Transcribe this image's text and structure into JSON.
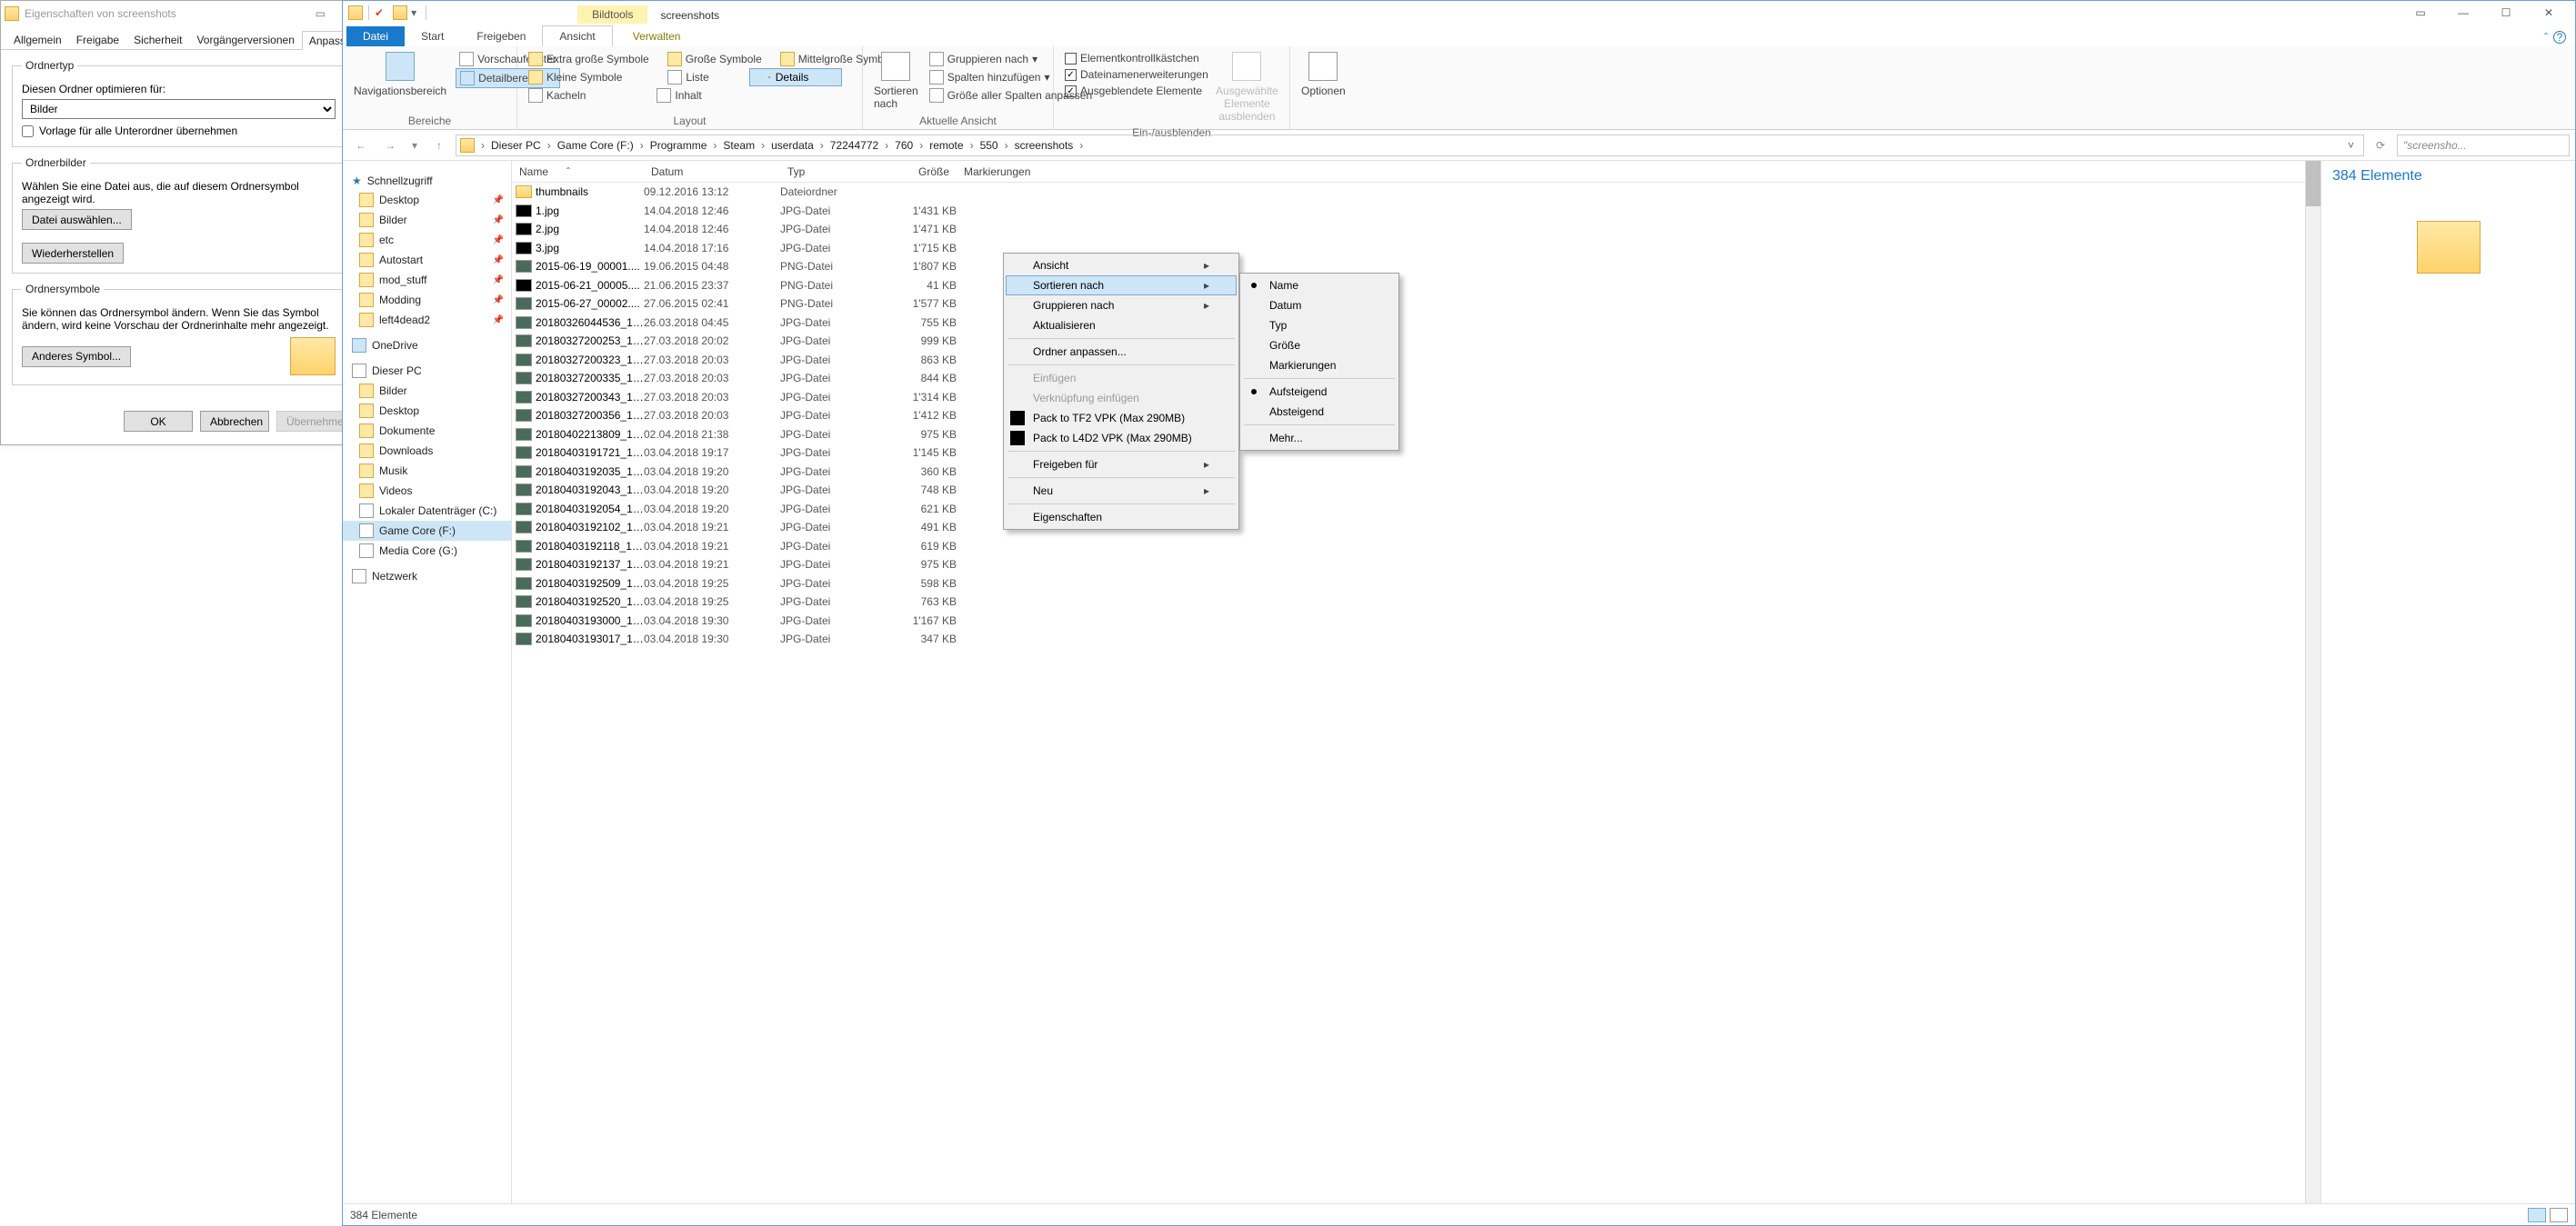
{
  "props": {
    "title": "Eigenschaften von screenshots",
    "tabs": [
      "Allgemein",
      "Freigabe",
      "Sicherheit",
      "Vorgängerversionen",
      "Anpassen"
    ],
    "group1": "Ordnertyp",
    "opt1": "Diesen Ordner optimieren für:",
    "select_value": "Bilder",
    "chk1": "Vorlage für alle Unterordner übernehmen",
    "group2": "Ordnerbilder",
    "opt2": "Wählen Sie eine Datei aus, die auf diesem Ordnersymbol angezeigt wird.",
    "btn_choose": "Datei auswählen...",
    "btn_restore": "Wiederherstellen",
    "group3": "Ordnersymbole",
    "opt3": "Sie können das Ordnersymbol ändern. Wenn Sie das Symbol ändern, wird keine Vorschau der Ordnerinhalte mehr angezeigt.",
    "btn_other": "Anderes Symbol...",
    "btn_ok": "OK",
    "btn_cancel": "Abbrechen",
    "btn_apply": "Übernehmen"
  },
  "explorer": {
    "tool_tab": "Bildtools",
    "folder_name": "screenshots",
    "tabs": {
      "file": "Datei",
      "start": "Start",
      "share": "Freigeben",
      "view": "Ansicht",
      "manage": "Verwalten"
    },
    "ribbon": {
      "nav_panel": "Navigationsbereich",
      "preview": "Vorschaufenster",
      "detail_area": "Detailbereich",
      "group1": "Bereiche",
      "layout": {
        "xlarge": "Extra große Symbole",
        "large": "Große Symbole",
        "medium": "Mittelgroße Symbole",
        "small": "Kleine Symbole",
        "list": "Liste",
        "details": "Details",
        "tiles": "Kacheln",
        "content": "Inhalt"
      },
      "group2": "Layout",
      "sort": "Sortieren nach",
      "group_by": "Gruppieren nach",
      "add_cols": "Spalten hinzufügen",
      "fit_cols": "Größe aller Spalten anpassen",
      "group3": "Aktuelle Ansicht",
      "chk_item": "Elementkontrollkästchen",
      "chk_ext": "Dateinamenerweiterungen",
      "chk_hidden": "Ausgeblendete Elemente",
      "hide_sel": "Ausgewählte Elemente ausblenden",
      "group4": "Ein-/ausblenden",
      "options": "Optionen"
    },
    "crumbs": [
      "Dieser PC",
      "Game Core (F:)",
      "Programme",
      "Steam",
      "userdata",
      "72244772",
      "760",
      "remote",
      "550",
      "screenshots"
    ],
    "search_placeholder": "\"screensho...",
    "nav": {
      "quick": "Schnellzugriff",
      "items": [
        "Desktop",
        "Bilder",
        "etc",
        "Autostart",
        "mod_stuff",
        "Modding",
        "left4dead2"
      ],
      "onedrive": "OneDrive",
      "thispc": "Dieser PC",
      "pc_items": [
        "Bilder",
        "Desktop",
        "Dokumente",
        "Downloads",
        "Musik",
        "Videos",
        "Lokaler Datenträger (C:)",
        "Game Core (F:)",
        "Media Core (G:)"
      ],
      "network": "Netzwerk"
    },
    "cols": {
      "name": "Name",
      "date": "Datum",
      "type": "Typ",
      "size": "Größe",
      "mark": "Markierungen"
    },
    "right_count": "384 Elemente",
    "status": "384 Elemente",
    "files": [
      {
        "n": "thumbnails",
        "d": "09.12.2016 13:12",
        "t": "Dateiordner",
        "s": "",
        "folder": true
      },
      {
        "n": "1.jpg",
        "d": "14.04.2018 12:46",
        "t": "JPG-Datei",
        "s": "1'431 KB",
        "black": true
      },
      {
        "n": "2.jpg",
        "d": "14.04.2018 12:46",
        "t": "JPG-Datei",
        "s": "1'471 KB",
        "black": true
      },
      {
        "n": "3.jpg",
        "d": "14.04.2018 17:16",
        "t": "JPG-Datei",
        "s": "1'715 KB",
        "black": true
      },
      {
        "n": "2015-06-19_00001....",
        "d": "19.06.2015 04:48",
        "t": "PNG-Datei",
        "s": "1'807 KB"
      },
      {
        "n": "2015-06-21_00005....",
        "d": "21.06.2015 23:37",
        "t": "PNG-Datei",
        "s": "41 KB",
        "black": true
      },
      {
        "n": "2015-06-27_00002....",
        "d": "27.06.2015 02:41",
        "t": "PNG-Datei",
        "s": "1'577 KB"
      },
      {
        "n": "20180326044536_1.j...",
        "d": "26.03.2018 04:45",
        "t": "JPG-Datei",
        "s": "755 KB"
      },
      {
        "n": "20180327200253_1.j...",
        "d": "27.03.2018 20:02",
        "t": "JPG-Datei",
        "s": "999 KB"
      },
      {
        "n": "20180327200323_1.j...",
        "d": "27.03.2018 20:03",
        "t": "JPG-Datei",
        "s": "863 KB"
      },
      {
        "n": "20180327200335_1.j...",
        "d": "27.03.2018 20:03",
        "t": "JPG-Datei",
        "s": "844 KB"
      },
      {
        "n": "20180327200343_1.j...",
        "d": "27.03.2018 20:03",
        "t": "JPG-Datei",
        "s": "1'314 KB"
      },
      {
        "n": "20180327200356_1.j...",
        "d": "27.03.2018 20:03",
        "t": "JPG-Datei",
        "s": "1'412 KB"
      },
      {
        "n": "20180402213809_1.j...",
        "d": "02.04.2018 21:38",
        "t": "JPG-Datei",
        "s": "975 KB"
      },
      {
        "n": "20180403191721_1.j...",
        "d": "03.04.2018 19:17",
        "t": "JPG-Datei",
        "s": "1'145 KB"
      },
      {
        "n": "20180403192035_1.j...",
        "d": "03.04.2018 19:20",
        "t": "JPG-Datei",
        "s": "360 KB"
      },
      {
        "n": "20180403192043_1.j...",
        "d": "03.04.2018 19:20",
        "t": "JPG-Datei",
        "s": "748 KB"
      },
      {
        "n": "20180403192054_1.j...",
        "d": "03.04.2018 19:20",
        "t": "JPG-Datei",
        "s": "621 KB"
      },
      {
        "n": "20180403192102_1.j...",
        "d": "03.04.2018 19:21",
        "t": "JPG-Datei",
        "s": "491 KB"
      },
      {
        "n": "20180403192118_1.j...",
        "d": "03.04.2018 19:21",
        "t": "JPG-Datei",
        "s": "619 KB"
      },
      {
        "n": "20180403192137_1.j...",
        "d": "03.04.2018 19:21",
        "t": "JPG-Datei",
        "s": "975 KB"
      },
      {
        "n": "20180403192509_1.j...",
        "d": "03.04.2018 19:25",
        "t": "JPG-Datei",
        "s": "598 KB"
      },
      {
        "n": "20180403192520_1.j...",
        "d": "03.04.2018 19:25",
        "t": "JPG-Datei",
        "s": "763 KB"
      },
      {
        "n": "20180403193000_1.j...",
        "d": "03.04.2018 19:30",
        "t": "JPG-Datei",
        "s": "1'167 KB"
      },
      {
        "n": "20180403193017_1.j...",
        "d": "03.04.2018 19:30",
        "t": "JPG-Datei",
        "s": "347 KB"
      }
    ]
  },
  "ctx1": {
    "view": "Ansicht",
    "sort": "Sortieren nach",
    "group": "Gruppieren nach",
    "refresh": "Aktualisieren",
    "customize": "Ordner anpassen...",
    "paste": "Einfügen",
    "paste_link": "Verknüpfung einfügen",
    "tf2": "Pack to TF2 VPK (Max 290MB)",
    "l4d2": "Pack to L4D2 VPK (Max 290MB)",
    "share": "Freigeben für",
    "new": "Neu",
    "props": "Eigenschaften"
  },
  "ctx2": {
    "name": "Name",
    "date": "Datum",
    "type": "Typ",
    "size": "Größe",
    "mark": "Markierungen",
    "asc": "Aufsteigend",
    "desc": "Absteigend",
    "more": "Mehr..."
  }
}
